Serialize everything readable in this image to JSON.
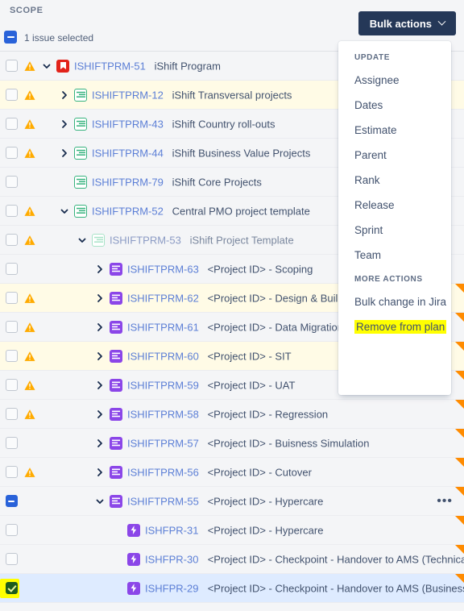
{
  "header": {
    "scope_label": "SCOPE",
    "selection_text": "1 issue selected",
    "bulk_actions_label": "Bulk actions"
  },
  "dropdown": {
    "sections": [
      {
        "title": "UPDATE",
        "items": [
          {
            "label": "Assignee",
            "highlighted": false
          },
          {
            "label": "Dates",
            "highlighted": false
          },
          {
            "label": "Estimate",
            "highlighted": false
          },
          {
            "label": "Parent",
            "highlighted": false
          },
          {
            "label": "Rank",
            "highlighted": false
          },
          {
            "label": "Release",
            "highlighted": false
          },
          {
            "label": "Sprint",
            "highlighted": false
          },
          {
            "label": "Team",
            "highlighted": false
          }
        ]
      },
      {
        "title": "MORE ACTIONS",
        "items": [
          {
            "label": "Bulk change in Jira",
            "highlighted": false
          },
          {
            "label": "Remove from plan",
            "highlighted": true
          }
        ]
      }
    ]
  },
  "colors": {
    "accent_blue": "#2962d9",
    "button_navy": "#253858",
    "link_blue": "#5c7fd6",
    "warning_amber": "#ffab00",
    "flag_orange": "#ff8b00",
    "epic_purple": "#8b46e8",
    "initiative_green": "#36b37e",
    "program_red": "#e2231a",
    "highlight_yellow": "#ffff00",
    "row_warn_bg": "#fffbe6",
    "row_selected_bg": "#deebff",
    "row_bg": "#f4f5f7"
  },
  "rows": [
    {
      "key": "ISHIFTPRM-51",
      "summary": "iShift Program",
      "indent": 0,
      "icon": "program-icon",
      "twisty": "down",
      "warning": true,
      "checkbox": "unchecked",
      "rowbg": "default",
      "flag": false,
      "more": false,
      "muted": false
    },
    {
      "key": "ISHIFTPRM-12",
      "summary": "iShift Transversal projects",
      "indent": 1,
      "icon": "initiative-icon",
      "twisty": "right",
      "warning": true,
      "checkbox": "unchecked",
      "rowbg": "warn",
      "flag": false,
      "more": false,
      "muted": false
    },
    {
      "key": "ISHIFTPRM-43",
      "summary": "iShift Country roll-outs",
      "indent": 1,
      "icon": "initiative-icon",
      "twisty": "right",
      "warning": true,
      "checkbox": "unchecked",
      "rowbg": "default",
      "flag": false,
      "more": false,
      "muted": false
    },
    {
      "key": "ISHIFTPRM-44",
      "summary": "iShift Business Value Projects",
      "indent": 1,
      "icon": "initiative-icon",
      "twisty": "right",
      "warning": true,
      "checkbox": "unchecked",
      "rowbg": "default",
      "flag": false,
      "more": false,
      "muted": false
    },
    {
      "key": "ISHIFTPRM-79",
      "summary": "iShift Core Projects",
      "indent": 1,
      "icon": "initiative-icon",
      "twisty": "none",
      "warning": false,
      "checkbox": "unchecked",
      "rowbg": "default",
      "flag": false,
      "more": false,
      "muted": false
    },
    {
      "key": "ISHIFTPRM-52",
      "summary": "Central PMO project template",
      "indent": 1,
      "icon": "initiative-icon",
      "twisty": "down",
      "warning": true,
      "checkbox": "unchecked",
      "rowbg": "default",
      "flag": false,
      "more": false,
      "muted": false
    },
    {
      "key": "ISHIFTPRM-53",
      "summary": "iShift Project Template",
      "indent": 2,
      "icon": "initiative-faded-icon",
      "twisty": "down",
      "warning": true,
      "checkbox": "unchecked",
      "rowbg": "default",
      "flag": false,
      "more": false,
      "muted": true
    },
    {
      "key": "ISHIFTPRM-63",
      "summary": "<Project ID> - Scoping",
      "indent": 3,
      "icon": "epic-icon",
      "twisty": "right",
      "warning": false,
      "checkbox": "unchecked",
      "rowbg": "default",
      "flag": false,
      "more": false,
      "muted": false
    },
    {
      "key": "ISHIFTPRM-62",
      "summary": "<Project ID> - Design & Build",
      "indent": 3,
      "icon": "epic-icon",
      "twisty": "right",
      "warning": true,
      "checkbox": "unchecked",
      "rowbg": "warn",
      "flag": true,
      "more": false,
      "muted": false
    },
    {
      "key": "ISHIFTPRM-61",
      "summary": "<Project ID> - Data Migration",
      "indent": 3,
      "icon": "epic-icon",
      "twisty": "right",
      "warning": true,
      "checkbox": "unchecked",
      "rowbg": "default",
      "flag": true,
      "more": false,
      "muted": false
    },
    {
      "key": "ISHIFTPRM-60",
      "summary": "<Project ID> - SIT",
      "indent": 3,
      "icon": "epic-icon",
      "twisty": "right",
      "warning": true,
      "checkbox": "unchecked",
      "rowbg": "warn",
      "flag": true,
      "more": false,
      "muted": false
    },
    {
      "key": "ISHIFTPRM-59",
      "summary": "<Project ID> - UAT",
      "indent": 3,
      "icon": "epic-icon",
      "twisty": "right",
      "warning": true,
      "checkbox": "unchecked",
      "rowbg": "default",
      "flag": true,
      "more": false,
      "muted": false
    },
    {
      "key": "ISHIFTPRM-58",
      "summary": "<Project ID> - Regression",
      "indent": 3,
      "icon": "epic-icon",
      "twisty": "right",
      "warning": true,
      "checkbox": "unchecked",
      "rowbg": "default",
      "flag": true,
      "more": false,
      "muted": false
    },
    {
      "key": "ISHIFTPRM-57",
      "summary": "<Project ID> - Buisness Simulation",
      "indent": 3,
      "icon": "epic-icon",
      "twisty": "right",
      "warning": false,
      "checkbox": "unchecked",
      "rowbg": "default",
      "flag": true,
      "more": false,
      "muted": false
    },
    {
      "key": "ISHIFTPRM-56",
      "summary": "<Project ID> - Cutover",
      "indent": 3,
      "icon": "epic-icon",
      "twisty": "right",
      "warning": true,
      "checkbox": "unchecked",
      "rowbg": "default",
      "flag": true,
      "more": false,
      "muted": false
    },
    {
      "key": "ISHIFTPRM-55",
      "summary": "<Project ID> - Hypercare",
      "indent": 3,
      "icon": "epic-icon",
      "twisty": "down",
      "warning": false,
      "checkbox": "indeterminate",
      "rowbg": "default",
      "flag": true,
      "more": true,
      "muted": false
    },
    {
      "key": "ISHFPR-31",
      "summary": "<Project ID> - Hypercare",
      "indent": 4,
      "icon": "bolt-icon",
      "twisty": "none",
      "warning": false,
      "checkbox": "unchecked",
      "rowbg": "default",
      "flag": true,
      "more": false,
      "muted": false
    },
    {
      "key": "ISHFPR-30",
      "summary": "<Project ID> - Checkpoint - Handover to AMS (Technical)",
      "indent": 4,
      "icon": "bolt-icon",
      "twisty": "none",
      "warning": false,
      "checkbox": "unchecked",
      "rowbg": "default",
      "flag": true,
      "more": false,
      "muted": false
    },
    {
      "key": "ISHFPR-29",
      "summary": "<Project ID> - Checkpoint - Handover to AMS (Business)",
      "indent": 4,
      "icon": "bolt-icon",
      "twisty": "none",
      "warning": false,
      "checkbox": "checked-highlighted",
      "rowbg": "selected",
      "flag": true,
      "more": false,
      "muted": false
    }
  ]
}
